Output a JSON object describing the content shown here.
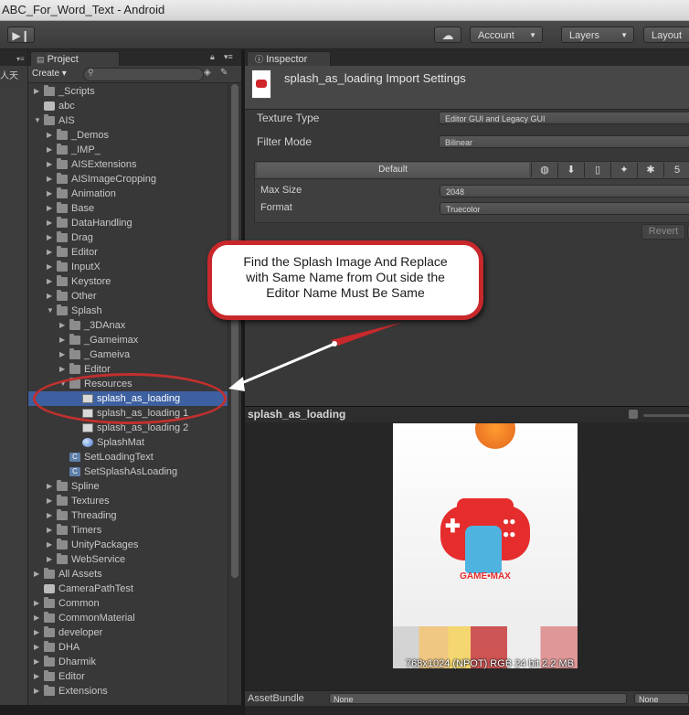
{
  "window": {
    "title": "ABC_For_Word_Text - Android"
  },
  "toolbar": {
    "play_icon": "play-step-icon",
    "cloud_icon": "cloud-icon",
    "account_label": "Account",
    "layers_label": "Layers",
    "layout_label": "Layout"
  },
  "left_strip": {
    "label": "人天"
  },
  "project": {
    "tab_label": "Project",
    "create_label": "Create",
    "tree": [
      {
        "label": "_Scripts",
        "icon": "folder",
        "depth": 0,
        "tri": "right"
      },
      {
        "label": "abc",
        "icon": "scene",
        "depth": 0,
        "tri": ""
      },
      {
        "label": "AIS",
        "icon": "folder",
        "depth": 0,
        "tri": "down"
      },
      {
        "label": "_Demos",
        "icon": "folder",
        "depth": 1,
        "tri": "right"
      },
      {
        "label": "_IMP_",
        "icon": "folder",
        "depth": 1,
        "tri": "right"
      },
      {
        "label": "AISExtensions",
        "icon": "folder",
        "depth": 1,
        "tri": "right"
      },
      {
        "label": "AISImageCropping",
        "icon": "folder",
        "depth": 1,
        "tri": "right"
      },
      {
        "label": "Animation",
        "icon": "folder",
        "depth": 1,
        "tri": "right"
      },
      {
        "label": "Base",
        "icon": "folder",
        "depth": 1,
        "tri": "right"
      },
      {
        "label": "DataHandling",
        "icon": "folder",
        "depth": 1,
        "tri": "right"
      },
      {
        "label": "Drag",
        "icon": "folder",
        "depth": 1,
        "tri": "right"
      },
      {
        "label": "Editor",
        "icon": "folder",
        "depth": 1,
        "tri": "right"
      },
      {
        "label": "InputX",
        "icon": "folder",
        "depth": 1,
        "tri": "right"
      },
      {
        "label": "Keystore",
        "icon": "folder",
        "depth": 1,
        "tri": "right"
      },
      {
        "label": "Other",
        "icon": "folder",
        "depth": 1,
        "tri": "right"
      },
      {
        "label": "Splash",
        "icon": "folder",
        "depth": 1,
        "tri": "down"
      },
      {
        "label": "_3DAnax",
        "icon": "folder",
        "depth": 2,
        "tri": "right"
      },
      {
        "label": "_Gameimax",
        "icon": "folder",
        "depth": 2,
        "tri": "right"
      },
      {
        "label": "_Gameiva",
        "icon": "folder",
        "depth": 2,
        "tri": "right"
      },
      {
        "label": "Editor",
        "icon": "folder",
        "depth": 2,
        "tri": "right"
      },
      {
        "label": "Resources",
        "icon": "folder",
        "depth": 2,
        "tri": "down"
      },
      {
        "label": "splash_as_loading",
        "icon": "image",
        "depth": 3,
        "tri": "",
        "selected": true
      },
      {
        "label": "splash_as_loading 1",
        "icon": "image",
        "depth": 3,
        "tri": ""
      },
      {
        "label": "splash_as_loading 2",
        "icon": "image",
        "depth": 3,
        "tri": ""
      },
      {
        "label": "SplashMat",
        "icon": "material",
        "depth": 3,
        "tri": ""
      },
      {
        "label": "SetLoadingText",
        "icon": "script",
        "depth": 2,
        "tri": ""
      },
      {
        "label": "SetSplashAsLoading",
        "icon": "script",
        "depth": 2,
        "tri": ""
      },
      {
        "label": "Spline",
        "icon": "folder",
        "depth": 1,
        "tri": "right"
      },
      {
        "label": "Textures",
        "icon": "folder",
        "depth": 1,
        "tri": "right"
      },
      {
        "label": "Threading",
        "icon": "folder",
        "depth": 1,
        "tri": "right"
      },
      {
        "label": "Timers",
        "icon": "folder",
        "depth": 1,
        "tri": "right"
      },
      {
        "label": "UnityPackages",
        "icon": "folder",
        "depth": 1,
        "tri": "right"
      },
      {
        "label": "WebService",
        "icon": "folder",
        "depth": 1,
        "tri": "right"
      },
      {
        "label": "All Assets",
        "icon": "folder",
        "depth": 0,
        "tri": "right"
      },
      {
        "label": "CameraPathTest",
        "icon": "scene",
        "depth": 0,
        "tri": ""
      },
      {
        "label": "Common",
        "icon": "folder",
        "depth": 0,
        "tri": "right"
      },
      {
        "label": "CommonMaterial",
        "icon": "folder",
        "depth": 0,
        "tri": "right"
      },
      {
        "label": "developer",
        "icon": "folder",
        "depth": 0,
        "tri": "right"
      },
      {
        "label": "DHA",
        "icon": "folder",
        "depth": 0,
        "tri": "right"
      },
      {
        "label": "Dharmik",
        "icon": "folder",
        "depth": 0,
        "tri": "right"
      },
      {
        "label": "Editor",
        "icon": "folder",
        "depth": 0,
        "tri": "right"
      },
      {
        "label": "Extensions",
        "icon": "folder",
        "depth": 0,
        "tri": "right"
      }
    ]
  },
  "inspector": {
    "tab_label": "Inspector",
    "title": "splash_as_loading Import Settings",
    "texture_type_label": "Texture Type",
    "texture_type_value": "Editor GUI and Legacy GUI",
    "filter_mode_label": "Filter Mode",
    "filter_mode_value": "Bilinear",
    "platform_default_label": "Default",
    "max_size_label": "Max Size",
    "max_size_value": "2048",
    "format_label": "Format",
    "format_value": "Truecolor",
    "revert_label": "Revert"
  },
  "preview": {
    "title": "splash_as_loading",
    "logo_text": "GAME•MAX",
    "info": "768x1024 (NPOT)  RGB 24 bit  2.2 MB"
  },
  "asset_bundle": {
    "label": "AssetBundle",
    "value1": "None",
    "value2": "None"
  },
  "annotation": {
    "callout_line1": "Find the Splash Image And Replace",
    "callout_line2": "with Same Name from Out side the",
    "callout_line3": "Editor Name Must Be Same"
  },
  "colors": {
    "selection": "#3d60a0",
    "callout_border": "#c8282c",
    "brand_red": "#e62d2d"
  }
}
